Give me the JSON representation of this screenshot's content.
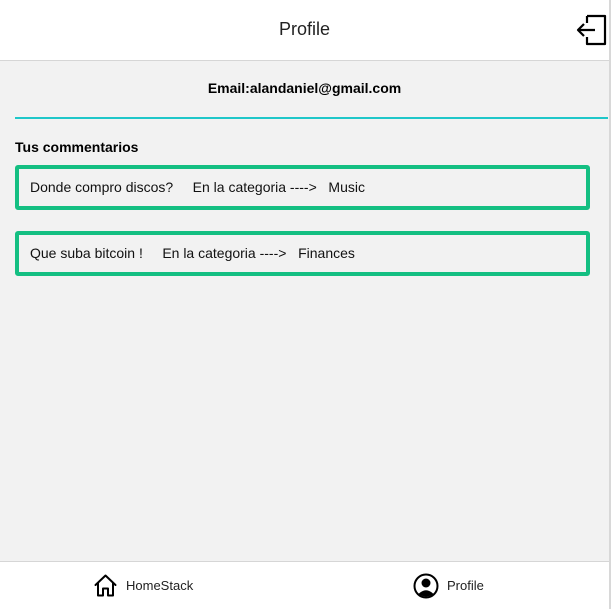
{
  "header": {
    "title": "Profile",
    "logout_icon": "logout-icon"
  },
  "profile": {
    "email": "Email:alandaniel@gmail.com"
  },
  "comments_section": {
    "title": "Tus commentarios",
    "items": [
      {
        "text": "Donde compro discos?",
        "category_prefix": "En la categoria ---->",
        "category": "Music"
      },
      {
        "text": "Que suba bitcoin !",
        "category_prefix": "En la categoria ---->",
        "category": "Finances"
      }
    ]
  },
  "tabbar": {
    "tabs": [
      {
        "label": "HomeStack",
        "icon": "home-icon"
      },
      {
        "label": "Profile",
        "icon": "user-circle-icon"
      }
    ]
  },
  "colors": {
    "accent_divider": "#1fc7c9",
    "comment_border": "#14bf82"
  }
}
